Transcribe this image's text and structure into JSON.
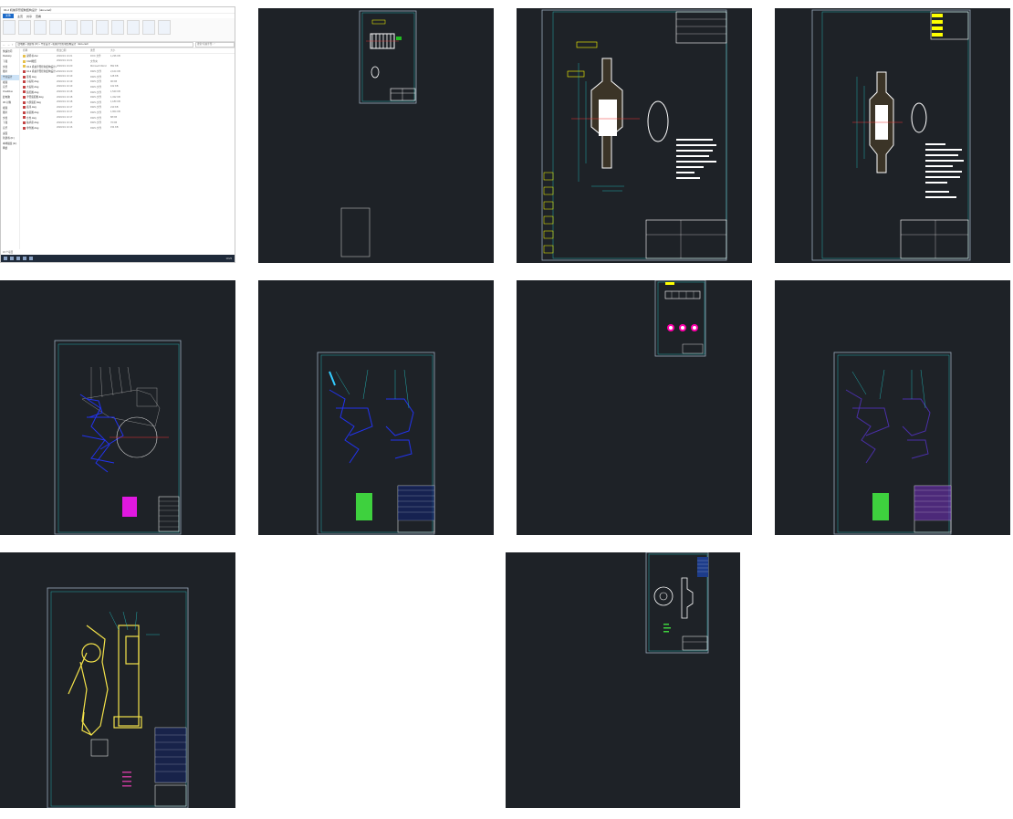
{
  "explorer": {
    "title": "04-2 机械手臂控制结构设计（doc+cad）",
    "tabs": [
      "文件",
      "主页",
      "共享",
      "查看"
    ],
    "path": "此电脑 › 新建卷 (D:) › 毕业设计 › 机械手臂控制结构设计（doc+cad）",
    "search_placeholder": "搜索\"机械手臂...\"",
    "nav_items": [
      "快速访问",
      "Desktop",
      "下载",
      "文档",
      "图片",
      "毕业设计",
      "视频",
      "音乐",
      "OneDrive",
      "此电脑",
      "3D 对象",
      "视频",
      "图片",
      "文档",
      "下载",
      "音乐",
      "桌面",
      "新建卷 (D:)",
      "本地磁盘 (E:)",
      "网络"
    ],
    "columns": [
      "名称",
      "修改日期",
      "类型",
      "大小"
    ],
    "files": [
      {
        "name": "说明书.doc",
        "date": "2020/4/1 10:21",
        "type": "DOC 文件",
        "size": "1,236 KB",
        "icon": "doc"
      },
      {
        "name": "CAD图纸",
        "date": "2020/4/1 10:21",
        "type": "文件夹",
        "size": "",
        "icon": "folder"
      },
      {
        "name": "04-2 机械手臂控制结构设计.docx",
        "date": "2020/4/1 10:20",
        "type": "Microsoft Word",
        "size": "852 KB",
        "icon": "doc"
      },
      {
        "name": "04-2 机械手臂控制结构设计.dwg",
        "date": "2020/4/1 10:20",
        "type": "DWG 文件",
        "size": "2,104 KB",
        "icon": "dwg"
      },
      {
        "name": "链轮.dwg",
        "date": "2020/4/1 10:19",
        "type": "DWG 文件",
        "size": "128 KB",
        "icon": "dwg"
      },
      {
        "name": "小齿轮.dwg",
        "date": "2020/4/1 10:19",
        "type": "DWG 文件",
        "size": "96 KB",
        "icon": "dwg"
      },
      {
        "name": "大齿轮.dwg",
        "date": "2020/4/1 10:19",
        "type": "DWG 文件",
        "size": "102 KB",
        "icon": "dwg"
      },
      {
        "name": "装配图.dwg",
        "date": "2020/4/1 10:18",
        "type": "DWG 文件",
        "size": "1,540 KB",
        "icon": "dwg"
      },
      {
        "name": "手臂装配图.dwg",
        "date": "2020/4/1 10:18",
        "type": "DWG 文件",
        "size": "1,322 KB",
        "icon": "dwg"
      },
      {
        "name": "爪部装配.dwg",
        "date": "2020/4/1 10:18",
        "type": "DWG 文件",
        "size": "1,180 KB",
        "icon": "dwg"
      },
      {
        "name": "底座.dwg",
        "date": "2020/4/1 10:17",
        "type": "DWG 文件",
        "size": "210 KB",
        "icon": "dwg"
      },
      {
        "name": "总装图.dwg",
        "date": "2020/4/1 10:17",
        "type": "DWG 文件",
        "size": "1,904 KB",
        "icon": "dwg"
      },
      {
        "name": "立柱.dwg",
        "date": "2020/4/1 10:17",
        "type": "DWG 文件",
        "size": "88 KB",
        "icon": "dwg"
      },
      {
        "name": "轴承座.dwg",
        "date": "2020/4/1 10:16",
        "type": "DWG 文件",
        "size": "76 KB",
        "icon": "dwg"
      },
      {
        "name": "零件图.dwg",
        "date": "2020/4/1 10:16",
        "type": "DWG 文件",
        "size": "154 KB",
        "icon": "dwg"
      }
    ],
    "status": "15 个项目",
    "clock": "10:23"
  },
  "drawings": [
    {
      "id": "gear-small"
    },
    {
      "id": "gear-part-1"
    },
    {
      "id": "gear-part-2"
    },
    {
      "id": "assembly-1"
    },
    {
      "id": "assembly-2"
    },
    {
      "id": "gear-set"
    },
    {
      "id": "assembly-3"
    },
    {
      "id": "arm-assembly-yellow"
    },
    {
      "id": "part-detail"
    }
  ]
}
